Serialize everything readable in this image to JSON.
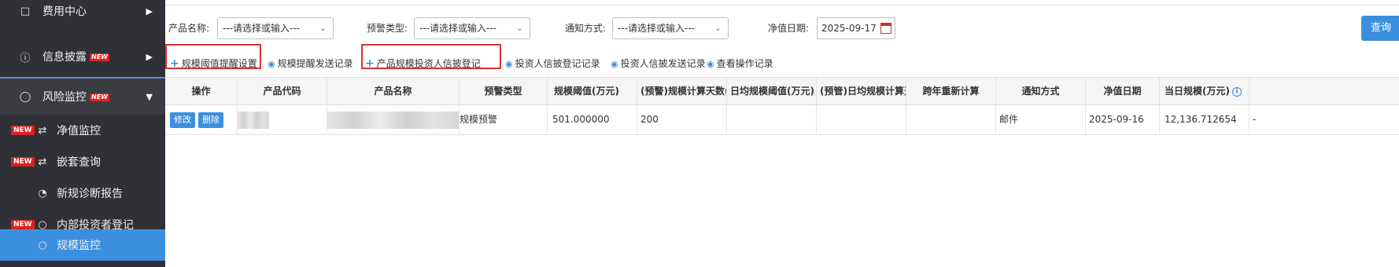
{
  "sidebar": {
    "items": [
      {
        "label": "费用中心",
        "icon": "document-icon"
      },
      {
        "label": "信息披露",
        "icon": "info-icon",
        "badge": "NEW"
      },
      {
        "label": "风险监控",
        "icon": "eye-slash-icon",
        "badge": "NEW"
      }
    ],
    "subitems": [
      {
        "label": "净值监控",
        "icon": "shuffle-icon",
        "badge": "NEW"
      },
      {
        "label": "嵌套查询",
        "icon": "shuffle-icon",
        "badge": "NEW"
      },
      {
        "label": "新规诊断报告",
        "icon": "pie-chart-icon"
      },
      {
        "label": "内部投资者登记",
        "icon": "user-icon",
        "badge": "NEW"
      },
      {
        "label": "规模监控",
        "icon": "user-icon"
      }
    ]
  },
  "filters": {
    "product_label": "产品名称:",
    "product_value": "---请选择或输入---",
    "warning_label": "预警类型:",
    "warning_value": "---请选择或输入---",
    "notify_label": "通知方式:",
    "notify_value": "---请选择或输入---",
    "date_label": "净值日期:",
    "date_value": "2025-09-17",
    "query_button": "查询"
  },
  "toolbar": {
    "threshold_setting": "规模阈值提醒设置",
    "reminder_log": "规模提醒发送记录",
    "disclosure_register": "产品规模投资人信披登记",
    "investor_register_log": "投资人信披登记记录",
    "investor_send_log": "投资人信披发送记录",
    "operation_log": "查看操作记录"
  },
  "table": {
    "columns": [
      "操作",
      "产品代码",
      "产品名称",
      "预警类型",
      "规模阈值(万元)",
      "(预警)规模计算天数(交易",
      "日均规模阈值(万元)",
      "(预管)日均规模计算天数",
      "跨年重新计算",
      "通知方式",
      "净值日期",
      "当日规模(万元)"
    ],
    "rows": [
      {
        "edit": "修改",
        "delete": "删除",
        "warning_type": "规模预警",
        "threshold": "501.000000",
        "days": "200",
        "notify": "邮件",
        "nav_date": "2025-09-16",
        "scale": "12,136.712654",
        "extra": "-"
      }
    ]
  },
  "colors": {
    "accent": "#3c8fde",
    "sidebar_bg": "#2f3136",
    "highlight_box": "#e03030",
    "new_badge": "#e02020"
  }
}
